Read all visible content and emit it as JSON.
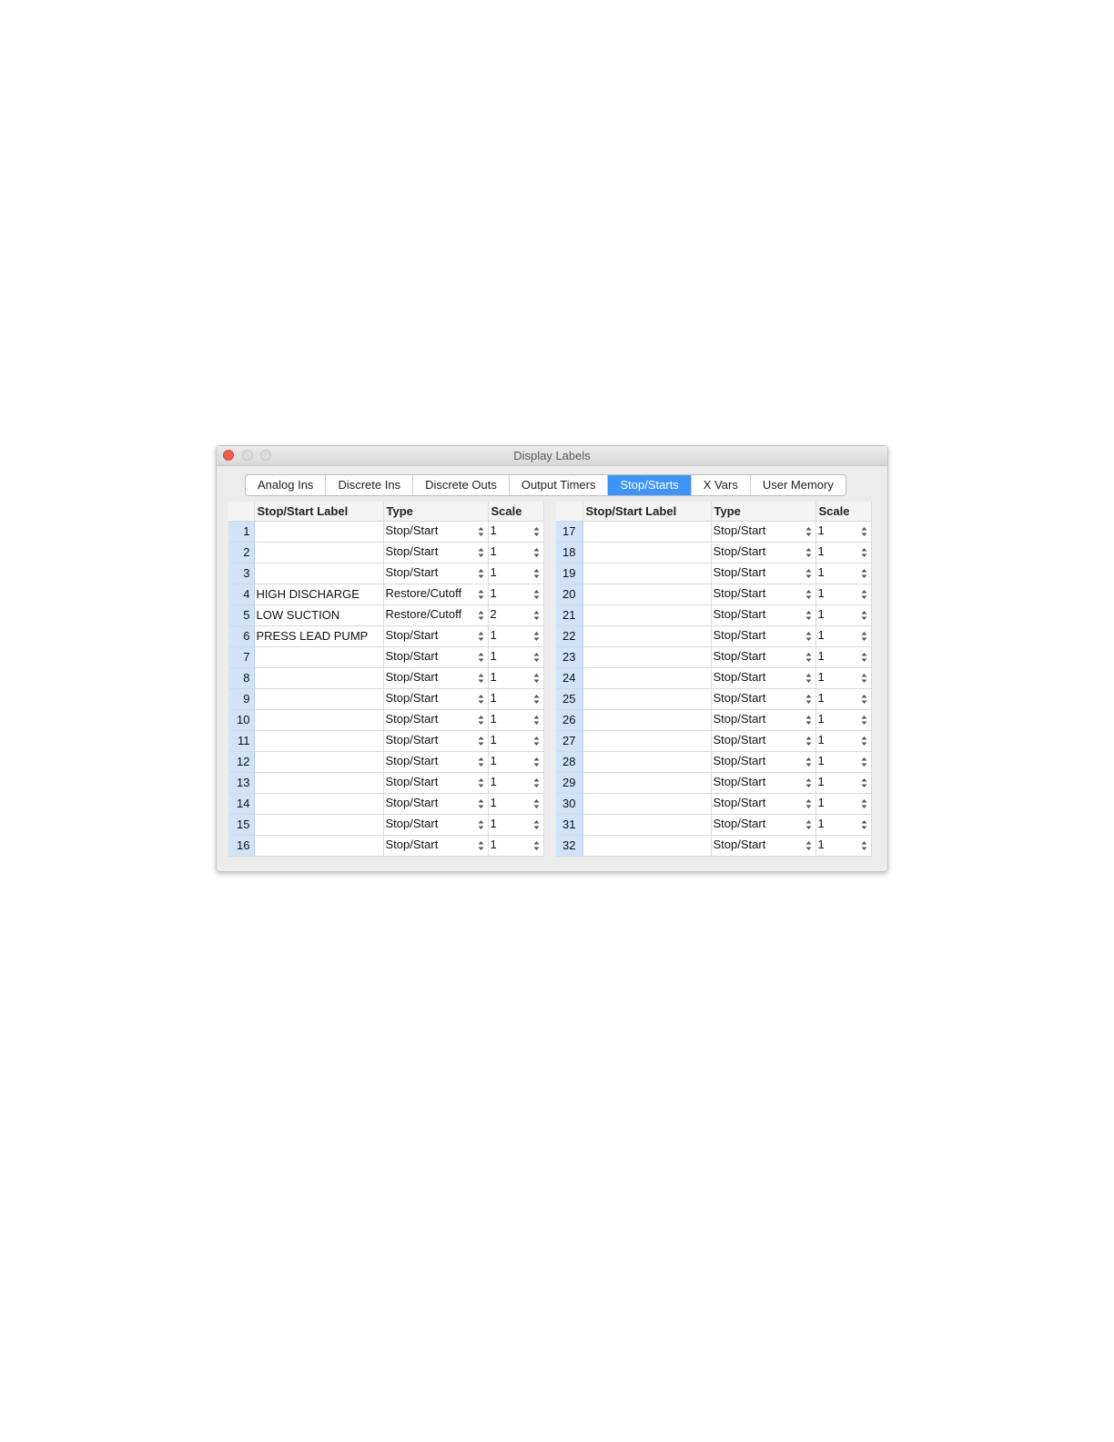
{
  "window": {
    "title": "Display Labels"
  },
  "tabs": [
    {
      "label": "Analog Ins",
      "active": false
    },
    {
      "label": "Discrete Ins",
      "active": false
    },
    {
      "label": "Discrete Outs",
      "active": false
    },
    {
      "label": "Output Timers",
      "active": false
    },
    {
      "label": "Stop/Starts",
      "active": true
    },
    {
      "label": "X Vars",
      "active": false
    },
    {
      "label": "User Memory",
      "active": false
    }
  ],
  "colors": {
    "active_tab": "#3d93f8",
    "row_number_bg": "#cfe3f9",
    "close_button": "#ee5b52"
  },
  "left_table": {
    "headers": {
      "label": "Stop/Start Label",
      "type": "Type",
      "scale": "Scale"
    },
    "rows": [
      {
        "num": "1",
        "label": "",
        "type": "Stop/Start",
        "scale": "1"
      },
      {
        "num": "2",
        "label": "",
        "type": "Stop/Start",
        "scale": "1"
      },
      {
        "num": "3",
        "label": "",
        "type": "Stop/Start",
        "scale": "1"
      },
      {
        "num": "4",
        "label": "HIGH DISCHARGE",
        "type": "Restore/Cutoff",
        "scale": "1"
      },
      {
        "num": "5",
        "label": "LOW SUCTION",
        "type": "Restore/Cutoff",
        "scale": "2"
      },
      {
        "num": "6",
        "label": "PRESS LEAD PUMP",
        "type": "Stop/Start",
        "scale": "1"
      },
      {
        "num": "7",
        "label": "",
        "type": "Stop/Start",
        "scale": "1"
      },
      {
        "num": "8",
        "label": "",
        "type": "Stop/Start",
        "scale": "1"
      },
      {
        "num": "9",
        "label": "",
        "type": "Stop/Start",
        "scale": "1"
      },
      {
        "num": "10",
        "label": "",
        "type": "Stop/Start",
        "scale": "1"
      },
      {
        "num": "11",
        "label": "",
        "type": "Stop/Start",
        "scale": "1"
      },
      {
        "num": "12",
        "label": "",
        "type": "Stop/Start",
        "scale": "1"
      },
      {
        "num": "13",
        "label": "",
        "type": "Stop/Start",
        "scale": "1"
      },
      {
        "num": "14",
        "label": "",
        "type": "Stop/Start",
        "scale": "1"
      },
      {
        "num": "15",
        "label": "",
        "type": "Stop/Start",
        "scale": "1"
      },
      {
        "num": "16",
        "label": "",
        "type": "Stop/Start",
        "scale": "1"
      }
    ]
  },
  "right_table": {
    "headers": {
      "label": "Stop/Start Label",
      "type": "Type",
      "scale": "Scale"
    },
    "rows": [
      {
        "num": "17",
        "label": "",
        "type": "Stop/Start",
        "scale": "1"
      },
      {
        "num": "18",
        "label": "",
        "type": "Stop/Start",
        "scale": "1"
      },
      {
        "num": "19",
        "label": "",
        "type": "Stop/Start",
        "scale": "1"
      },
      {
        "num": "20",
        "label": "",
        "type": "Stop/Start",
        "scale": "1"
      },
      {
        "num": "21",
        "label": "",
        "type": "Stop/Start",
        "scale": "1"
      },
      {
        "num": "22",
        "label": "",
        "type": "Stop/Start",
        "scale": "1"
      },
      {
        "num": "23",
        "label": "",
        "type": "Stop/Start",
        "scale": "1"
      },
      {
        "num": "24",
        "label": "",
        "type": "Stop/Start",
        "scale": "1"
      },
      {
        "num": "25",
        "label": "",
        "type": "Stop/Start",
        "scale": "1"
      },
      {
        "num": "26",
        "label": "",
        "type": "Stop/Start",
        "scale": "1"
      },
      {
        "num": "27",
        "label": "",
        "type": "Stop/Start",
        "scale": "1"
      },
      {
        "num": "28",
        "label": "",
        "type": "Stop/Start",
        "scale": "1"
      },
      {
        "num": "29",
        "label": "",
        "type": "Stop/Start",
        "scale": "1"
      },
      {
        "num": "30",
        "label": "",
        "type": "Stop/Start",
        "scale": "1"
      },
      {
        "num": "31",
        "label": "",
        "type": "Stop/Start",
        "scale": "1"
      },
      {
        "num": "32",
        "label": "",
        "type": "Stop/Start",
        "scale": "1"
      }
    ]
  }
}
